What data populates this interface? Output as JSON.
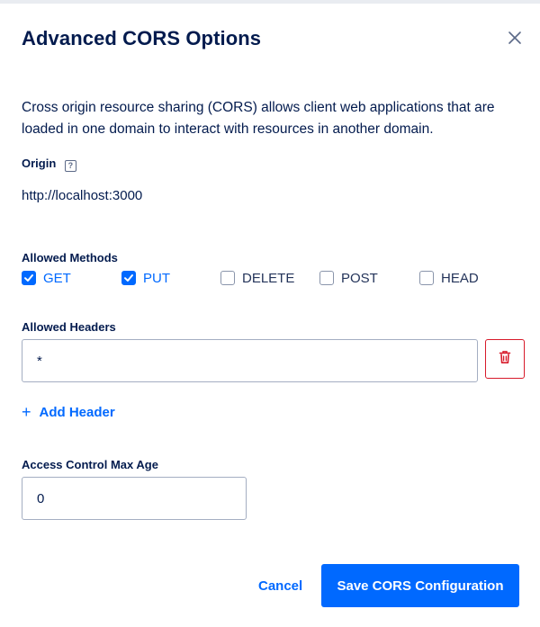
{
  "dialog": {
    "title": "Advanced CORS Options",
    "close_icon": "close-icon",
    "description": "Cross origin resource sharing (CORS) allows client web applications that are loaded in one domain to interact with resources in another domain."
  },
  "origin": {
    "label": "Origin",
    "help_glyph": "?",
    "value": "http://localhost:3000"
  },
  "allowed_methods": {
    "label": "Allowed Methods",
    "methods": [
      {
        "label": "GET",
        "checked": true
      },
      {
        "label": "PUT",
        "checked": true
      },
      {
        "label": "DELETE",
        "checked": false
      },
      {
        "label": "POST",
        "checked": false
      },
      {
        "label": "HEAD",
        "checked": false
      }
    ]
  },
  "allowed_headers": {
    "label": "Allowed Headers",
    "header_value": "*",
    "delete_icon": "trash-icon",
    "add_label": "Add Header"
  },
  "max_age": {
    "label": "Access Control Max Age",
    "value": "0"
  },
  "footer": {
    "cancel_label": "Cancel",
    "save_label": "Save CORS Configuration"
  },
  "colors": {
    "accent": "#0069ff",
    "text": "#031b4e",
    "danger": "#d71a2a"
  }
}
